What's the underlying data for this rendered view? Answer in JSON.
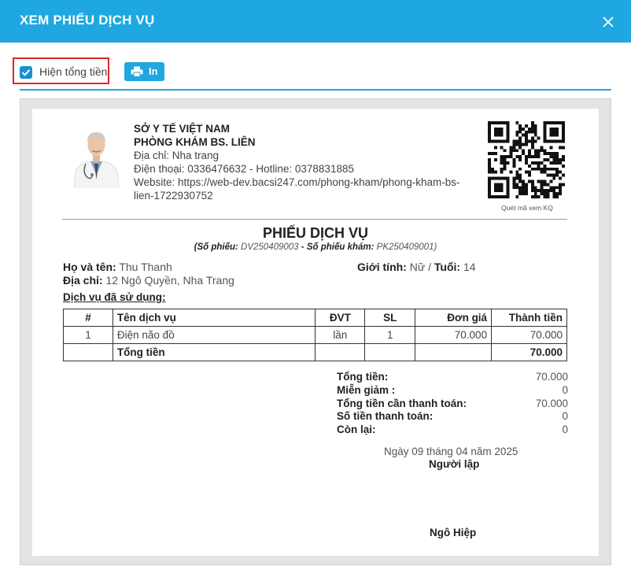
{
  "modal": {
    "title": "XEM PHIẾU DỊCH VỤ"
  },
  "toolbar": {
    "show_total_label": "Hiện tổng tiền",
    "show_total_checked": true,
    "print_label": "In"
  },
  "colors": {
    "accent": "#1ea7e0",
    "highlight_border": "#e0262b"
  },
  "clinic": {
    "dept": "SỞ Y TẾ VIỆT NAM",
    "name": "PHÒNG KHÁM BS. LIÊN",
    "address": "Địa chỉ: Nha trang",
    "phone": "Điện thoại: 0336476632 - Hotline: 0378831885",
    "website_line1": "Website: https://web-dev.bacsi247.com/phong-kham/phong-kham-bs-",
    "website_line2": "lien-1722930752"
  },
  "qr_caption": "Quét mã xem KQ",
  "doc": {
    "title": "PHIẾU DỊCH VỤ",
    "so_phieu_label": "(Số phiếu:",
    "so_phieu": "DV250409003",
    "sep": "-",
    "so_phieu_kham_label": "Số phiếu khám:",
    "so_phieu_kham": "PK250409001)"
  },
  "patient": {
    "name_label": "Họ và tên:",
    "name": "Thu Thanh",
    "address_label": "Địa chỉ:",
    "address": "12 Ngô Quyền, Nha Trang",
    "gender_label": "Giới tính:",
    "gender": "Nữ",
    "slash": "/",
    "age_label": "Tuổi:",
    "age": "14"
  },
  "services": {
    "title": "Dịch vụ đã sử dụng:",
    "headers": [
      "#",
      "Tên dịch vụ",
      "ĐVT",
      "SL",
      "Đơn giá",
      "Thành tiền"
    ],
    "rows": [
      {
        "no": "1",
        "name": "Điện não đồ",
        "unit": "lần",
        "qty": "1",
        "price": "70.000",
        "total": "70.000"
      }
    ],
    "total_label": "Tổng tiền",
    "total_value": "70.000"
  },
  "summary": [
    {
      "label": "Tổng tiền:",
      "value": "70.000"
    },
    {
      "label": "Miễn giảm :",
      "value": "0"
    },
    {
      "label": "Tổng tiền cần thanh toán:",
      "value": "70.000"
    },
    {
      "label": "Số tiền thanh toán:",
      "value": "0"
    },
    {
      "label": "Còn lại:",
      "value": "0"
    }
  ],
  "sign": {
    "date": "Ngày 09 tháng 04 năm 2025",
    "role": "Người lập",
    "name": "Ngô Hiệp"
  }
}
